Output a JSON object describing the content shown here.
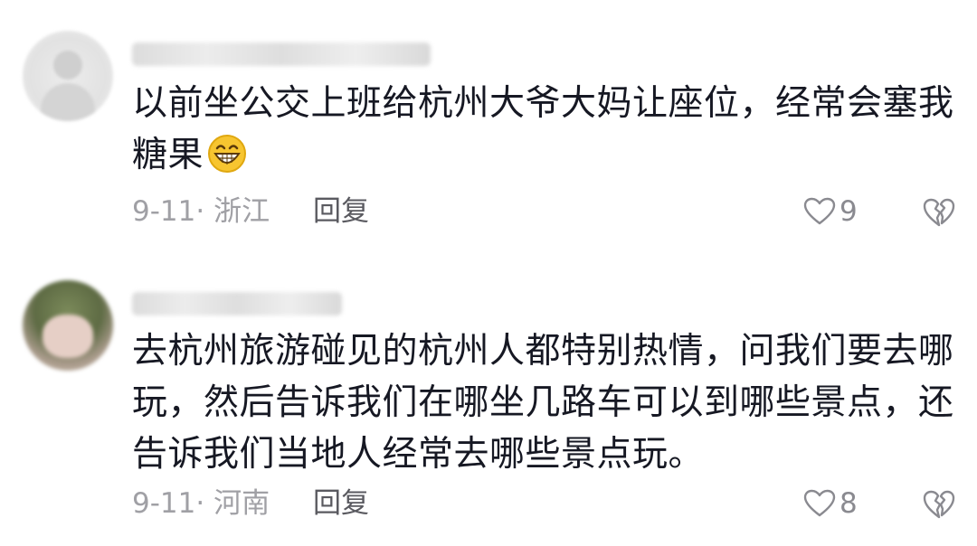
{
  "comments": [
    {
      "text_line1": "以前坐公交上班给杭州大爷大妈让座位，经常会塞我",
      "text_line2": "糖果",
      "emoji": "grinning-face-emoji",
      "date": "9-11",
      "region": "浙江",
      "reply_label": "回复",
      "like_count": "9"
    },
    {
      "text_line1": "去杭州旅游碰见的杭州人都特别热情，问我们要去哪",
      "text_line2": "玩，然后告诉我们在哪坐几路车可以到哪些景点，还",
      "text_line3": "告诉我们当地人经常去哪些景点玩。",
      "date": "9-11",
      "region": "河南",
      "reply_label": "回复",
      "like_count": "8"
    }
  ],
  "colors": {
    "text": "#161823",
    "meta": "#a0a0a5",
    "reply": "#5a5a60",
    "icon": "#8a8a90",
    "emoji_fill": "#f7c530"
  }
}
